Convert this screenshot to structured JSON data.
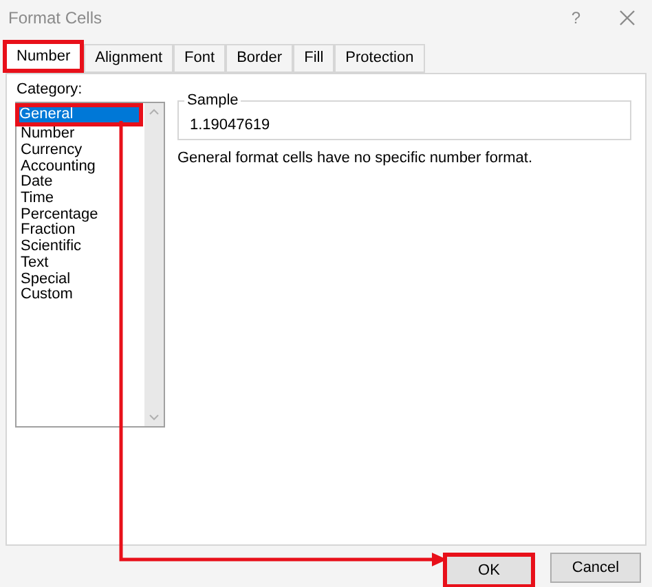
{
  "window": {
    "title": "Format Cells",
    "help": "?"
  },
  "tabs": [
    {
      "label": "Number",
      "selected": true,
      "highlighted": true
    },
    {
      "label": "Alignment",
      "selected": false,
      "highlighted": false
    },
    {
      "label": "Font",
      "selected": false,
      "highlighted": false
    },
    {
      "label": "Border",
      "selected": false,
      "highlighted": false
    },
    {
      "label": "Fill",
      "selected": false,
      "highlighted": false
    },
    {
      "label": "Protection",
      "selected": false,
      "highlighted": false
    }
  ],
  "category": {
    "label": "Category:",
    "items": [
      {
        "label": "General",
        "selected": true,
        "highlighted": true
      },
      {
        "label": "Number",
        "selected": false,
        "highlighted": false
      },
      {
        "label": "Currency",
        "selected": false,
        "highlighted": false
      },
      {
        "label": "Accounting",
        "selected": false,
        "highlighted": false
      },
      {
        "label": "Date",
        "selected": false,
        "highlighted": false
      },
      {
        "label": "Time",
        "selected": false,
        "highlighted": false
      },
      {
        "label": "Percentage",
        "selected": false,
        "highlighted": false
      },
      {
        "label": "Fraction",
        "selected": false,
        "highlighted": false
      },
      {
        "label": "Scientific",
        "selected": false,
        "highlighted": false
      },
      {
        "label": "Text",
        "selected": false,
        "highlighted": false
      },
      {
        "label": "Special",
        "selected": false,
        "highlighted": false
      },
      {
        "label": "Custom",
        "selected": false,
        "highlighted": false
      }
    ]
  },
  "sample": {
    "label": "Sample",
    "value": "1.19047619"
  },
  "description": "General format cells have no specific number format.",
  "buttons": [
    {
      "label": "OK",
      "highlighted": true
    },
    {
      "label": "Cancel",
      "highlighted": false
    }
  ]
}
